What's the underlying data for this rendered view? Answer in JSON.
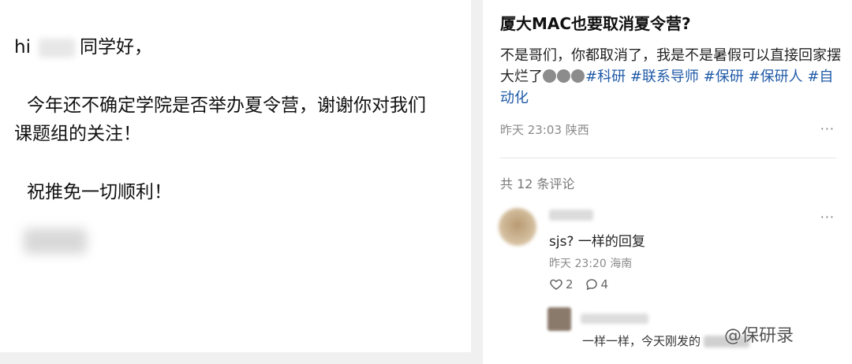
{
  "email": {
    "greeting_pre": "hi",
    "greeting_post": "同学好，",
    "body_line1": "今年还不确定学院是否举办夏令营，谢谢你对我们",
    "body_line2": "课题组的关注！",
    "closing": "祝推免一切顺利！"
  },
  "post": {
    "title": "厦大MAC也要取消夏令营?",
    "text": "不是哥们，你都取消了，我是不是暑假可以直接回家摆大烂了",
    "tag_1": "#科研",
    "tag_2": "#联系导师",
    "tag_3": "#保研",
    "tag_4": "#保研人",
    "tag_5": "#自动化",
    "time_location": "昨天 23:03 陕西",
    "more": "···"
  },
  "comments": {
    "count_label": "共 12 条评论",
    "items": [
      {
        "text": "sjs? 一样的回复",
        "time_location": "昨天 23:20 海南",
        "likes": "2",
        "replies": "4",
        "more": "···"
      }
    ],
    "reply": {
      "text": "一样一样，今天刚发的"
    }
  },
  "watermark": "@保研录",
  "colors": {
    "tag": "#1f5aa8",
    "meta": "#8a8a8a"
  }
}
